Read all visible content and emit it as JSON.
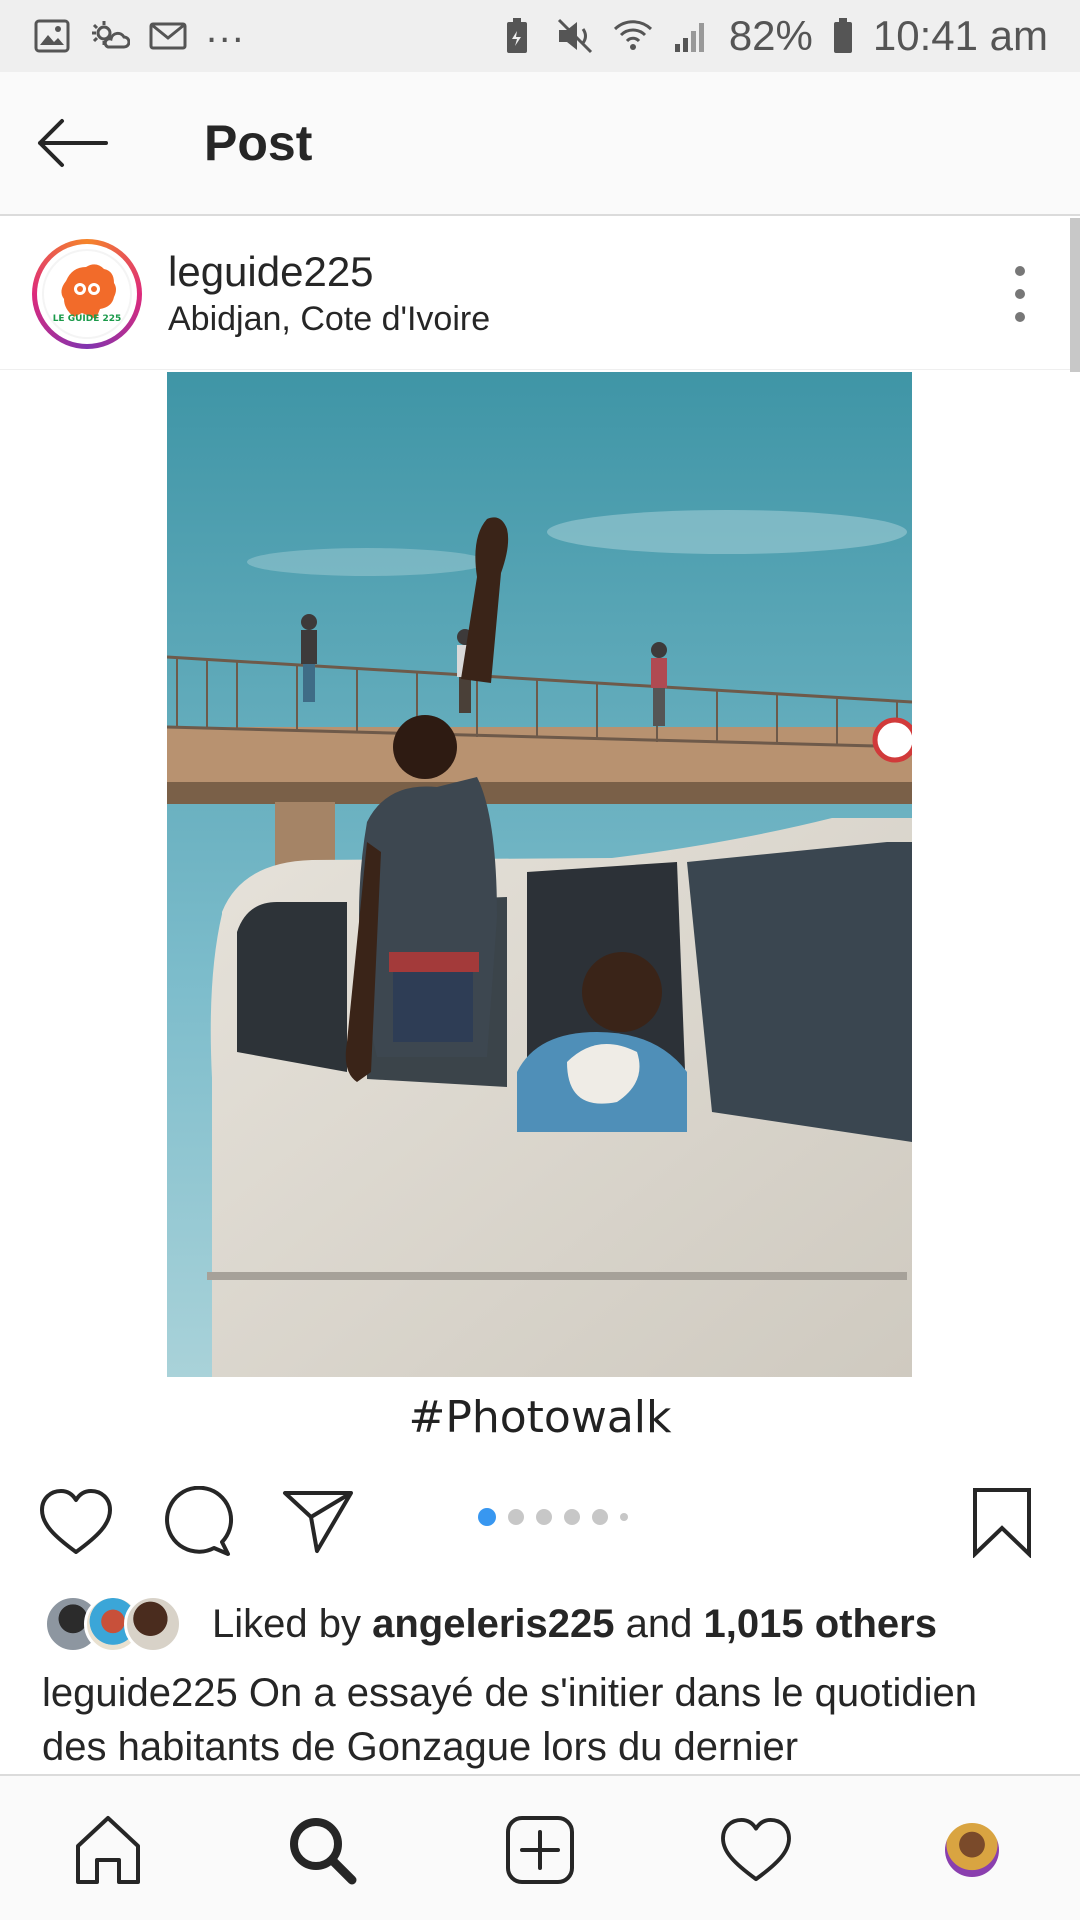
{
  "status_bar": {
    "left_icons": [
      "image-icon",
      "weather-icon",
      "mail-icon"
    ],
    "overflow": "...",
    "right_icons": [
      "battery-saver-icon",
      "mute-icon",
      "wifi-icon",
      "signal-icon"
    ],
    "battery": "82%",
    "time": "10:41 am"
  },
  "header": {
    "title": "Post",
    "back_icon": "arrow-left-icon"
  },
  "post": {
    "username": "leguide225",
    "location": "Abidjan, Cote d'Ivoire",
    "avatar_text": "LE GUIDE 225",
    "photo_caption_overlay": "#Photowalk",
    "carousel": {
      "count": 6,
      "active_index": 0
    },
    "likes": {
      "prefix": "Liked by",
      "liker": "angeleris225",
      "joiner": "and",
      "others": "1,015 others"
    },
    "caption": {
      "author": "leguide225",
      "text": "On a essayé de s'initier dans le quotidien des habitants de Gonzague lors du dernier"
    }
  },
  "actions": [
    "like-icon",
    "comment-icon",
    "share-icon",
    "bookmark-icon"
  ],
  "bottom_nav": [
    "home-icon",
    "search-icon",
    "new-post-icon",
    "activity-icon",
    "profile-avatar"
  ],
  "colors": {
    "accent_blue": "#3897f0",
    "text": "#262626",
    "status_bar_bg": "#efefef",
    "header_bg": "#fafafa"
  }
}
